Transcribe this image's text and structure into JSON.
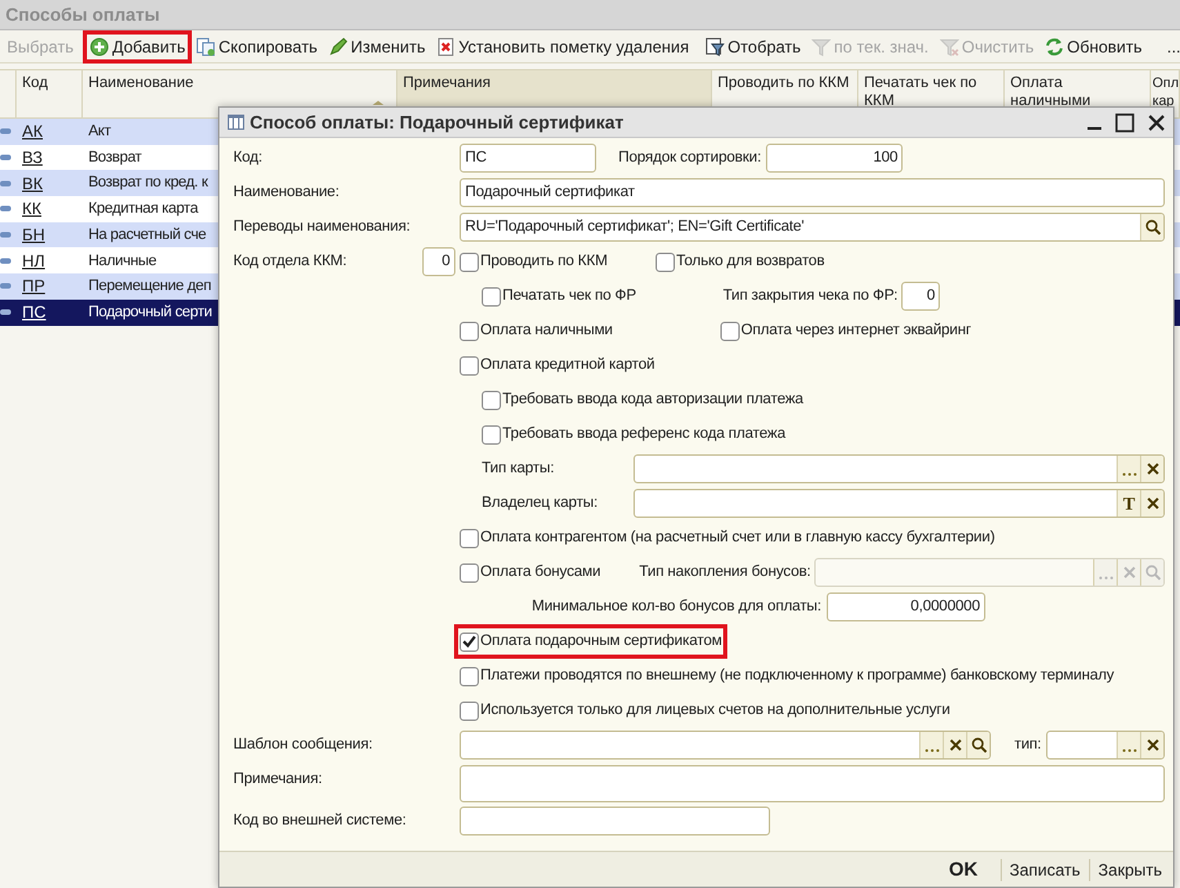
{
  "window": {
    "title": "Способы оплаты"
  },
  "toolbar": [
    {
      "kind": "select",
      "label": "Выбрать",
      "disabled": true,
      "highlighted": false
    },
    {
      "kind": "add",
      "label": "Добавить",
      "disabled": false,
      "highlighted": true
    },
    {
      "kind": "copy",
      "label": "Скопировать",
      "disabled": false,
      "highlighted": false
    },
    {
      "kind": "edit",
      "label": "Изменить",
      "disabled": false,
      "highlighted": false
    },
    {
      "kind": "delete",
      "label": "Установить пометку удаления",
      "disabled": false,
      "highlighted": false
    },
    {
      "kind": "filter",
      "label": "Отобрать",
      "disabled": false,
      "highlighted": false
    },
    {
      "kind": "filter_value",
      "label": "по тек. знач.",
      "disabled": true,
      "highlighted": false
    },
    {
      "kind": "clear_filter",
      "label": "Очистить",
      "disabled": true,
      "highlighted": false
    },
    {
      "kind": "refresh",
      "label": "Обновить",
      "disabled": false,
      "highlighted": false
    },
    {
      "kind": "more",
      "label": "...",
      "disabled": false,
      "highlighted": false
    }
  ],
  "table": {
    "columns": [
      "Код",
      "Наименование",
      "Примечания",
      "Проводить по ККМ",
      "Печатать чек по ККМ",
      "Оплата наличными",
      "Опл кар"
    ],
    "rows": [
      {
        "code": "АК",
        "name": "Акт",
        "selected": false
      },
      {
        "code": "ВЗ",
        "name": "Возврат",
        "selected": false
      },
      {
        "code": "ВК",
        "name": "Возврат по кред. к",
        "selected": false
      },
      {
        "code": "КК",
        "name": "Кредитная карта",
        "selected": false
      },
      {
        "code": "БН",
        "name": "На расчетный сче",
        "selected": false
      },
      {
        "code": "НЛ",
        "name": "Наличные",
        "selected": false
      },
      {
        "code": "ПР",
        "name": "Перемещение деп",
        "selected": false
      },
      {
        "code": "ПС",
        "name": "Подарочный серти",
        "selected": true
      }
    ]
  },
  "dialog": {
    "title": "Способ оплаты: Подарочный сертификат",
    "rows": [
      {
        "kind": "code_sort",
        "label": "Код:",
        "value": "ПС",
        "label_2": "Порядок сортировки:",
        "value_2": "100"
      },
      {
        "kind": "field",
        "label": "Наименование:",
        "value": "Подарочный сертификат"
      },
      {
        "kind": "field",
        "label": "Переводы наименования:",
        "value": "RU='Подарочный сертификат'; EN='Gift Certificate'",
        "buttons": [
          {
            "kind": "search"
          }
        ]
      },
      {
        "kind": "number_checks",
        "label": "Код отдела ККМ:",
        "value": "0",
        "checks": [
          {
            "label": "Проводить по ККМ",
            "checked": false
          },
          {
            "label": "Только для возвратов",
            "checked": false
          }
        ]
      },
      {
        "kind": "nested_check_field",
        "checks": [
          {
            "label": "Печатать чек по ФР",
            "checked": false
          }
        ],
        "label_2": "Тип закрытия чека по ФР:",
        "value_2": "0"
      },
      {
        "kind": "checks",
        "checks": [
          {
            "label": "Оплата наличными",
            "checked": false
          },
          {
            "label": "Оплата через интернет эквайринг",
            "checked": false
          }
        ]
      },
      {
        "kind": "checks",
        "checks": [
          {
            "label": "Оплата кредитной картой",
            "checked": false
          }
        ]
      },
      {
        "kind": "nested_checks",
        "checks": [
          {
            "label": "Требовать ввода кода авторизации платежа",
            "checked": false
          }
        ]
      },
      {
        "kind": "nested_checks",
        "checks": [
          {
            "label": "Требовать ввода референс кода платежа",
            "checked": false
          }
        ]
      },
      {
        "kind": "nested_field",
        "label": "Тип карты:",
        "buttons": [
          {
            "kind": "select"
          },
          {
            "kind": "clear"
          }
        ]
      },
      {
        "kind": "nested_field",
        "label": "Владелец карты:",
        "buttons": [
          {
            "kind": "text",
            "label": "T"
          },
          {
            "kind": "clear"
          }
        ]
      },
      {
        "kind": "checks",
        "checks": [
          {
            "label": "Оплата контрагентом (на расчетный счет или в главную кассу бухгалтерии)",
            "checked": false
          }
        ]
      },
      {
        "kind": "check_field",
        "checks": [
          {
            "label": "Оплата бонусами",
            "checked": false
          }
        ],
        "label_2": "Тип накопления бонусов:",
        "disabled": true,
        "buttons": [
          {
            "kind": "select"
          },
          {
            "kind": "clear"
          },
          {
            "kind": "search"
          }
        ]
      },
      {
        "kind": "right_number",
        "label": "Минимальное кол-во бонусов для оплаты:",
        "value": "0,0000000"
      },
      {
        "kind": "checks",
        "highlighted": true,
        "checks": [
          {
            "label": "Оплата подарочным сертификатом",
            "checked": true
          }
        ]
      },
      {
        "kind": "checks",
        "checks": [
          {
            "label": "Платежи проводятся по внешнему (не подключенному к программе) банковскому терминалу",
            "checked": false
          }
        ]
      },
      {
        "kind": "checks",
        "checks": [
          {
            "label": "Используется только для лицевых счетов на дополнительные услуги",
            "checked": false
          }
        ]
      },
      {
        "kind": "field_pair",
        "label": "Шаблон сообщения:",
        "buttons": [
          {
            "kind": "select"
          },
          {
            "kind": "clear"
          },
          {
            "kind": "search"
          }
        ],
        "label_2": "тип:",
        "buttons_2": [
          {
            "kind": "select"
          },
          {
            "kind": "clear"
          }
        ]
      },
      {
        "kind": "tall_field",
        "label": "Примечания:"
      },
      {
        "kind": "short_field",
        "label": "Код во внешней системе:"
      }
    ],
    "buttons": [
      {
        "label": "OK",
        "default": true
      },
      {
        "label": "Записать",
        "default": false
      },
      {
        "label": "Закрыть",
        "default": false
      }
    ]
  }
}
